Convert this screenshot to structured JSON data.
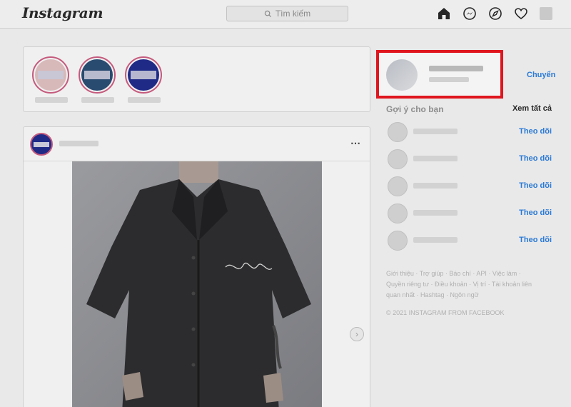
{
  "header": {
    "logo": "Instagram",
    "search_placeholder": "Tìm kiếm",
    "icons": [
      "home-icon",
      "messenger-icon",
      "explore-icon",
      "activity-icon",
      "profile-avatar"
    ]
  },
  "stories": {
    "items": [
      {
        "ring_color": "#c55a7d",
        "fill": "#d8b9b9"
      },
      {
        "ring_color": "#c55a7d",
        "fill": "#2a4b70"
      },
      {
        "ring_color": "#c55a7d",
        "fill": "#1f2a87"
      },
      {
        "ring_color": "#c55a7d",
        "fill": "#1f2a87"
      }
    ]
  },
  "post": {
    "more_icon": "⋯",
    "next_icon": "›"
  },
  "sidebar": {
    "switch_label": "Chuyển",
    "suggestions_title": "Gợi ý cho bạn",
    "see_all_label": "Xem tất cả",
    "follow_label": "Theo dõi",
    "suggestions": [
      {
        "follow": "Theo dõi"
      },
      {
        "follow": "Theo dõi"
      },
      {
        "follow": "Theo dõi"
      },
      {
        "follow": "Theo dõi"
      },
      {
        "follow": "Theo dõi"
      }
    ],
    "footer_links": "Giới thiệu · Trợ giúp · Báo chí · API · Việc làm · Quyền riêng tư · Điều khoản · Vị trí · Tài khoản liên quan nhất · Hashtag · Ngôn ngữ",
    "copyright": "© 2021 INSTAGRAM FROM FACEBOOK"
  },
  "colors": {
    "accent": "#2a7ad6",
    "highlight": "#e0161f",
    "story_ring": "#c55a7d"
  }
}
